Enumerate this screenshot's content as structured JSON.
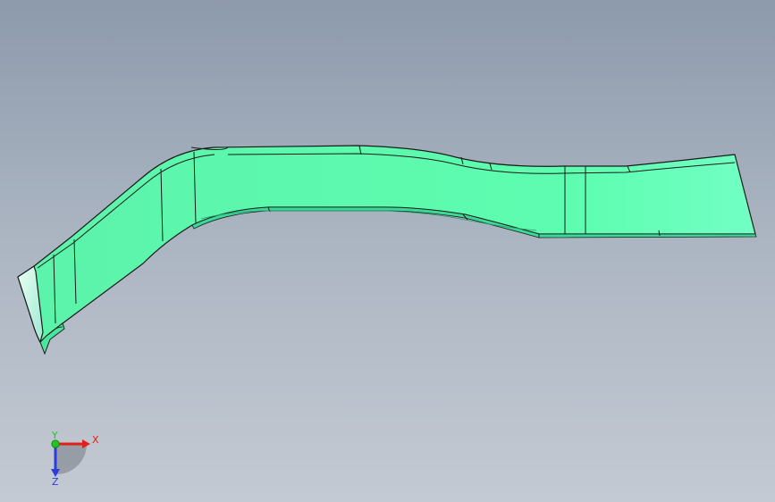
{
  "viewport": {
    "background_top": "#8d9aac",
    "background_bottom": "#c4cad3"
  },
  "model": {
    "part": "bent-sheet-metal-bracket",
    "color": "#5dffb0",
    "edge_color": "#1a1a1a"
  },
  "triad": {
    "x_label": "X",
    "y_label": "Y",
    "z_label": "Z",
    "x_color": "#e0201a",
    "y_color": "#1ec81e",
    "z_color": "#2a3cdc"
  }
}
